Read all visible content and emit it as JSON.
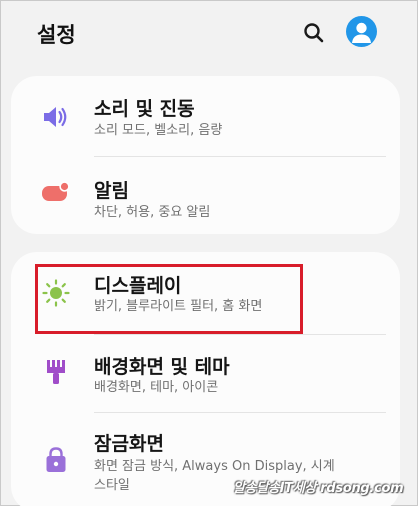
{
  "header": {
    "title": "설정",
    "search_icon": "search-icon",
    "profile_icon": "account-icon"
  },
  "colors": {
    "sound_icon": "#7b6ce6",
    "notification_icon": "#ee6f6a",
    "display_icon": "#8bc34a",
    "wallpaper_icon": "#a04dc9",
    "lockscreen_icon": "#9a70d9",
    "profile_bg": "#2196e8",
    "highlight": "#d81d2a"
  },
  "items": {
    "sound": {
      "title": "소리 및 진동",
      "subtitle": "소리 모드, 벨소리, 음량",
      "icon": "volume-icon"
    },
    "notifications": {
      "title": "알림",
      "subtitle": "차단, 허용, 중요 알림",
      "icon": "notification-icon"
    },
    "display": {
      "title": "디스플레이",
      "subtitle": "밝기, 블루라이트 필터, 홈 화면",
      "icon": "brightness-icon"
    },
    "wallpaper": {
      "title": "배경화면 및 테마",
      "subtitle": "배경화면, 테마, 아이콘",
      "icon": "paintbrush-icon"
    },
    "lockscreen": {
      "title": "잠금화면",
      "subtitle_line1": "화면 잠금 방식, Always On Display, 시계",
      "subtitle_line2": "스타일",
      "icon": "lock-icon"
    }
  },
  "watermark": "알송달송IT세상 rdsong.com"
}
